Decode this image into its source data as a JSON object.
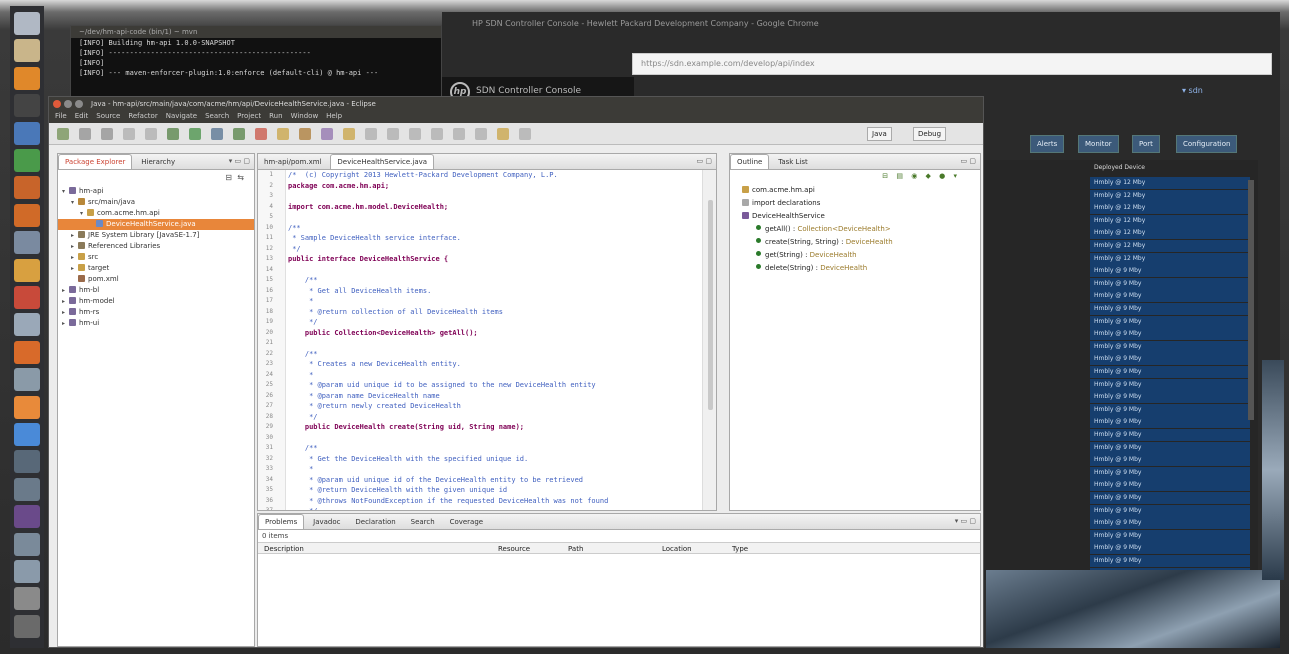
{
  "launcher": {
    "items": [
      {
        "name": "dash-icon",
        "color": "#b0b8c4"
      },
      {
        "name": "files-icon",
        "color": "#c9b58a"
      },
      {
        "name": "firefox-icon",
        "color": "#e0882a"
      },
      {
        "name": "terminal-icon",
        "color": "#444444"
      },
      {
        "name": "writer-icon",
        "color": "#4a78b8"
      },
      {
        "name": "calc-icon",
        "color": "#4a9a4a"
      },
      {
        "name": "impress-icon",
        "color": "#c8642a"
      },
      {
        "name": "software-center-icon",
        "color": "#d06a28"
      },
      {
        "name": "settings-icon",
        "color": "#7a8aa0"
      },
      {
        "name": "chat-icon",
        "color": "#d8a040"
      },
      {
        "name": "mail-icon",
        "color": "#c84a3a"
      },
      {
        "name": "documents-icon",
        "color": "#9aa8b8"
      },
      {
        "name": "browser-icon",
        "color": "#d86a2a"
      },
      {
        "name": "system-icon",
        "color": "#8a9aa8"
      },
      {
        "name": "ubuntu-one-icon",
        "color": "#e88a3a"
      },
      {
        "name": "chrome-icon",
        "color": "#4a8ad8"
      },
      {
        "name": "workspace-icon",
        "color": "#586878"
      },
      {
        "name": "monitor-icon",
        "color": "#6a7a8a"
      },
      {
        "name": "eclipse-icon",
        "color": "#6a4a8a"
      },
      {
        "name": "vm-icon",
        "color": "#7a8a9a"
      },
      {
        "name": "network-icon",
        "color": "#8a9aaa"
      },
      {
        "name": "disk-icon",
        "color": "#8a8a8a"
      },
      {
        "name": "trash-icon",
        "color": "#6a6a6a"
      }
    ]
  },
  "terminal": {
    "title": "~/dev/hm-api-code (bin/1) ~ mvn",
    "lines": [
      "[INFO] Building hm-api 1.0.0-SNAPSHOT",
      "[INFO] ------------------------------------------------",
      "[INFO]",
      "[INFO] --- maven-enforcer-plugin:1.0:enforce (default-cli) @ hm-api ---"
    ]
  },
  "browser": {
    "title": "HP SDN Controller Console - Hewlett Packard Development Company - Google Chrome",
    "url": "https://sdn.example.com/develop/api/index",
    "app_name": "SDN Controller Console",
    "user": "▾ sdn",
    "tabs": [
      "Alerts",
      "Monitor",
      "Port",
      "Configuration"
    ],
    "column_header": "Deployed Device",
    "row_label_12": "Hmbly @ 12 Mby",
    "row_label_9": "Hmbly @ 9 Mby"
  },
  "eclipse": {
    "title": "Java - hm-api/src/main/java/com/acme/hm/api/DeviceHealthService.java - Eclipse",
    "menu": [
      "File",
      "Edit",
      "Source",
      "Refactor",
      "Navigate",
      "Search",
      "Project",
      "Run",
      "Window",
      "Help"
    ],
    "perspectives": [
      "Java",
      "Debug"
    ],
    "explorer": {
      "tabs": [
        "Package Explorer",
        "Hierarchy"
      ],
      "tree": [
        {
          "label": "hm-api",
          "indent": 0,
          "arrow": "▾",
          "icon": "#7a6a9a"
        },
        {
          "label": "src/main/java",
          "indent": 1,
          "arrow": "▾",
          "icon": "#b8883a"
        },
        {
          "label": "com.acme.hm.api",
          "indent": 2,
          "arrow": "▾",
          "icon": "#c8a048"
        },
        {
          "label": "DeviceHealthService.java",
          "indent": 3,
          "arrow": "",
          "icon": "#6a8ac8",
          "selected": true
        },
        {
          "label": "JRE System Library [JavaSE-1.7]",
          "indent": 1,
          "arrow": "▸",
          "icon": "#8a7a5a"
        },
        {
          "label": "Referenced Libraries",
          "indent": 1,
          "arrow": "▸",
          "icon": "#8a7a5a"
        },
        {
          "label": "src",
          "indent": 1,
          "arrow": "▸",
          "icon": "#c8a048"
        },
        {
          "label": "target",
          "indent": 1,
          "arrow": "▸",
          "icon": "#c8a048"
        },
        {
          "label": "pom.xml",
          "indent": 1,
          "arrow": "",
          "icon": "#9a6a4a"
        },
        {
          "label": "hm-bl",
          "indent": 0,
          "arrow": "▸",
          "icon": "#7a6a9a"
        },
        {
          "label": "hm-model",
          "indent": 0,
          "arrow": "▸",
          "icon": "#7a6a9a"
        },
        {
          "label": "hm-rs",
          "indent": 0,
          "arrow": "▸",
          "icon": "#7a6a9a"
        },
        {
          "label": "hm-ui",
          "indent": 0,
          "arrow": "▸",
          "icon": "#7a6a9a"
        }
      ]
    },
    "editor": {
      "tabs": [
        "hm-api/pom.xml",
        "DeviceHealthService.java"
      ],
      "lines": [
        {
          "n": "1",
          "t": "/*  (c) Copyright 2013 Hewlett-Packard Development Company, L.P.",
          "c": "cm"
        },
        {
          "n": "2",
          "t": "package com.acme.hm.api;",
          "c": "kw"
        },
        {
          "n": "3",
          "t": "",
          "c": "plain"
        },
        {
          "n": "4",
          "t": "import com.acme.hm.model.DeviceHealth;",
          "c": "kw"
        },
        {
          "n": "5",
          "t": "",
          "c": "plain"
        },
        {
          "n": "10",
          "t": "/**",
          "c": "cm"
        },
        {
          "n": "11",
          "t": " * Sample DeviceHealth service interface.",
          "c": "cm"
        },
        {
          "n": "12",
          "t": " */",
          "c": "cm"
        },
        {
          "n": "13",
          "t": "public interface DeviceHealthService {",
          "c": "kw"
        },
        {
          "n": "14",
          "t": "",
          "c": "plain"
        },
        {
          "n": "15",
          "t": "    /**",
          "c": "cm"
        },
        {
          "n": "16",
          "t": "     * Get all DeviceHealth items.",
          "c": "cm"
        },
        {
          "n": "17",
          "t": "     *",
          "c": "cm"
        },
        {
          "n": "18",
          "t": "     * @return collection of all DeviceHealth items",
          "c": "cm"
        },
        {
          "n": "19",
          "t": "     */",
          "c": "cm"
        },
        {
          "n": "20",
          "t": "    public Collection<DeviceHealth> getAll();",
          "c": "kw"
        },
        {
          "n": "21",
          "t": "",
          "c": "plain"
        },
        {
          "n": "22",
          "t": "    /**",
          "c": "cm"
        },
        {
          "n": "23",
          "t": "     * Creates a new DeviceHealth entity.",
          "c": "cm"
        },
        {
          "n": "24",
          "t": "     *",
          "c": "cm"
        },
        {
          "n": "25",
          "t": "     * @param uid unique id to be assigned to the new DeviceHealth entity",
          "c": "cm"
        },
        {
          "n": "26",
          "t": "     * @param name DeviceHealth name",
          "c": "cm"
        },
        {
          "n": "27",
          "t": "     * @return newly created DeviceHealth",
          "c": "cm"
        },
        {
          "n": "28",
          "t": "     */",
          "c": "cm"
        },
        {
          "n": "29",
          "t": "    public DeviceHealth create(String uid, String name);",
          "c": "kw"
        },
        {
          "n": "30",
          "t": "",
          "c": "plain"
        },
        {
          "n": "31",
          "t": "    /**",
          "c": "cm"
        },
        {
          "n": "32",
          "t": "     * Get the DeviceHealth with the specified unique id.",
          "c": "cm"
        },
        {
          "n": "33",
          "t": "     *",
          "c": "cm"
        },
        {
          "n": "34",
          "t": "     * @param uid unique id of the DeviceHealth entity to be retrieved",
          "c": "cm"
        },
        {
          "n": "35",
          "t": "     * @return DeviceHealth with the given unique id",
          "c": "cm"
        },
        {
          "n": "36",
          "t": "     * @throws NotFoundException if the requested DeviceHealth was not found",
          "c": "cm"
        },
        {
          "n": "37",
          "t": "     */",
          "c": "cm"
        }
      ]
    },
    "outline": {
      "tabs": [
        "Outline",
        "Task List"
      ],
      "items": [
        {
          "label": "com.acme.hm.api",
          "indent": 0,
          "type": "pkg"
        },
        {
          "label": "import declarations",
          "indent": 0,
          "type": "imp"
        },
        {
          "label": "DeviceHealthService",
          "indent": 0,
          "type": "iface"
        },
        {
          "label": "getAll() : Collection<DeviceHealth>",
          "indent": 1,
          "type": "m"
        },
        {
          "label": "create(String, String) : DeviceHealth",
          "indent": 1,
          "type": "m"
        },
        {
          "label": "get(String) : DeviceHealth",
          "indent": 1,
          "type": "m"
        },
        {
          "label": "delete(String) : DeviceHealth",
          "indent": 1,
          "type": "m"
        }
      ]
    },
    "problems": {
      "tabs": [
        "Problems",
        "Javadoc",
        "Declaration",
        "Search",
        "Coverage"
      ],
      "count": "0 items",
      "columns": [
        "Description",
        "Resource",
        "Path",
        "Location",
        "Type"
      ]
    }
  }
}
